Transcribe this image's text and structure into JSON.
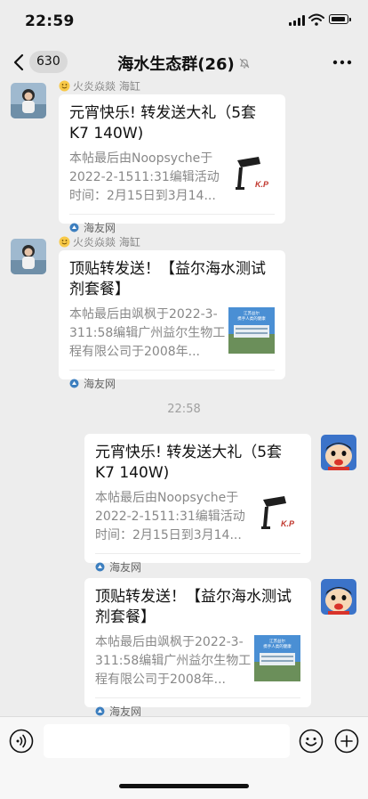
{
  "status_bar": {
    "time": "22:59"
  },
  "header": {
    "back_count": "630",
    "title": "海水生态群(26)"
  },
  "messages": [
    {
      "sender": "火炎焱燚 海缸",
      "title": "元宵快乐! 转发送大礼（5套K7 140W)",
      "desc": "本帖最后由Noopsyche于2022-2-1511:31编辑活动时间：2月15日到3月14...",
      "source": "海友网"
    },
    {
      "sender": "火炎焱燚 海缸",
      "title": "顶贴转发送！【益尔海水测试剂套餐】",
      "desc": "本帖最后由飒枫于2022-3-311:58编辑广州益尔生物工程有限公司于2008年...",
      "source": "海友网"
    }
  ],
  "timestamp": "22:58",
  "my_messages": [
    {
      "title": "元宵快乐! 转发送大礼（5套K7 140W)",
      "desc": "本帖最后由Noopsyche于2022-2-1511:31编辑活动时间：2月15日到3月14...",
      "source": "海友网"
    },
    {
      "title": "顶贴转发送！【益尔海水测试剂套餐】",
      "desc": "本帖最后由飒枫于2022-3-311:58编辑广州益尔生物工程有限公司于2008年...",
      "source": "海友网"
    }
  ],
  "thumb_text": {
    "brand": "K.P",
    "line1": "江苏益尔",
    "line2": "携手人类的健康"
  },
  "colors": {
    "background": "#ededed",
    "card": "#ffffff",
    "muted_text": "#888888",
    "source_icon": "#3d7fbf"
  },
  "icons": [
    "back-chevron-icon",
    "mute-bell-icon",
    "more-dots-icon",
    "smile-emoji-icon",
    "source-logo-icon",
    "voice-icon",
    "emoji-icon",
    "plus-icon"
  ]
}
